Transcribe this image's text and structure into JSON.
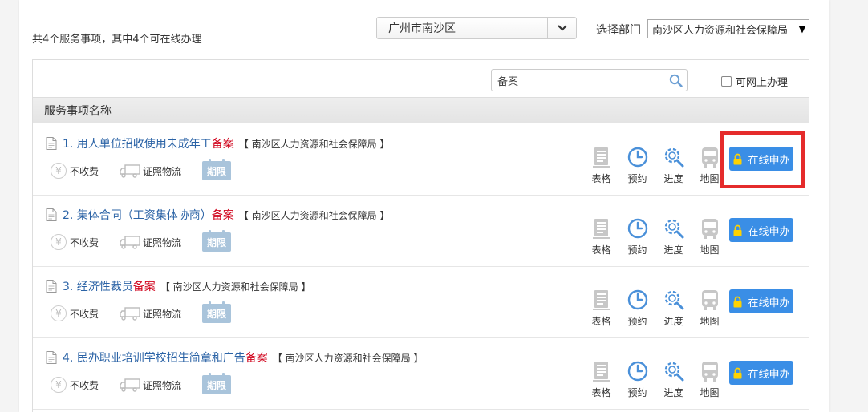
{
  "summary": "共4个服务事项，其中4个可在线办理",
  "region": {
    "value": "广州市南沙区"
  },
  "department": {
    "label": "选择部门",
    "value": "南沙区人力资源和社会保障局"
  },
  "search": {
    "value": "备案"
  },
  "online_filter": {
    "label": "可网上办理",
    "checked": false
  },
  "column_header": "服务事项名称",
  "feature_labels": {
    "fee": "不收费",
    "logistics": "证照物流",
    "deadline": "期限"
  },
  "action_labels": {
    "form": "表格",
    "appointment": "预约",
    "progress": "进度",
    "map": "地图"
  },
  "apply_label": "在线申办",
  "items": [
    {
      "name": "1. 用人单位招收使用未成年工",
      "tag": "备案",
      "dept": "【 南沙区人力资源和社会保障局 】"
    },
    {
      "name": "2. 集体合同（工资集体协商）",
      "tag": "备案",
      "dept": "【 南沙区人力资源和社会保障局 】"
    },
    {
      "name": "3. 经济性裁员",
      "tag": "备案",
      "dept": "【 南沙区人力资源和社会保障局 】"
    },
    {
      "name": "4. 民办职业培训学校招生简章和广告",
      "tag": "备案",
      "dept": "【 南沙区人力资源和社会保障局 】"
    }
  ],
  "colors": {
    "accent": "#3a8ee6",
    "link": "#2b63a6",
    "tag": "#d0021b",
    "highlight": "#e52b2b"
  }
}
